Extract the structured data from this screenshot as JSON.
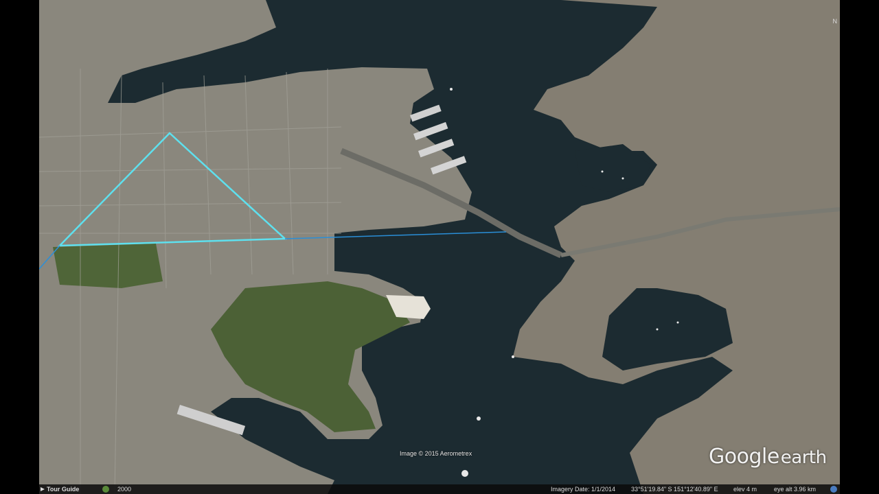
{
  "map": {
    "copyright": "Image © 2015 Aerometrex",
    "logo_main": "Google",
    "logo_sub": "earth",
    "compass_label": "N",
    "colors": {
      "water": "#1c2b31",
      "land_city": "#8d8c84",
      "parkland": "#4a5e33",
      "path_line": "#5ee0ee",
      "path_line_thin": "#2a8fd8"
    },
    "path_type": "triangle measurement path"
  },
  "statusbar": {
    "tour_guide": "Tour Guide",
    "history_icon": "clock-history-icon",
    "year": "2000",
    "imagery_date": "Imagery Date: 1/1/2014",
    "coords": "33°51'19.84\" S  151°12'40.89\" E",
    "elev": "elev  4 m",
    "eye_alt": "eye alt  3.96 km"
  }
}
